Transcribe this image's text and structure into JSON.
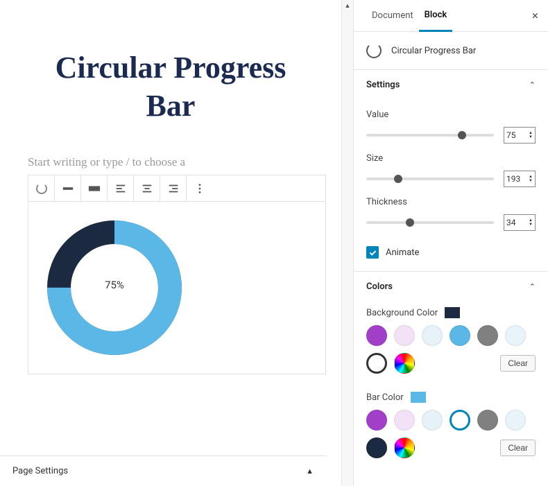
{
  "editor": {
    "title": "Circular Progress Bar",
    "placeholder": "Start writing or type / to choose a",
    "progress_label": "75%",
    "page_settings": "Page Settings"
  },
  "sidebar": {
    "tabs": {
      "document": "Document",
      "block": "Block"
    },
    "block_name": "Circular Progress Bar",
    "settings": {
      "title": "Settings",
      "value": {
        "label": "Value",
        "value": "75",
        "pct": 75
      },
      "size": {
        "label": "Size",
        "value": "193",
        "pct": 25
      },
      "thickness": {
        "label": "Thickness",
        "value": "34",
        "pct": 34
      },
      "animate": {
        "label": "Animate"
      }
    },
    "colors": {
      "title": "Colors",
      "bg": {
        "label": "Background Color",
        "hex": "#1b2a40",
        "clear": "Clear"
      },
      "bar": {
        "label": "Bar Color",
        "hex": "#5bb7e5",
        "clear": "Clear"
      }
    },
    "palette": [
      "#a23fc9",
      "#f3e2f7",
      "#e6f2f8",
      "#5bb7e5",
      "#808080",
      "#e8f4fa"
    ]
  },
  "chart": {
    "value": 75,
    "size": 193,
    "thickness": 34,
    "bg_color": "#1b2a40",
    "bar_color": "#5bb7e5"
  }
}
